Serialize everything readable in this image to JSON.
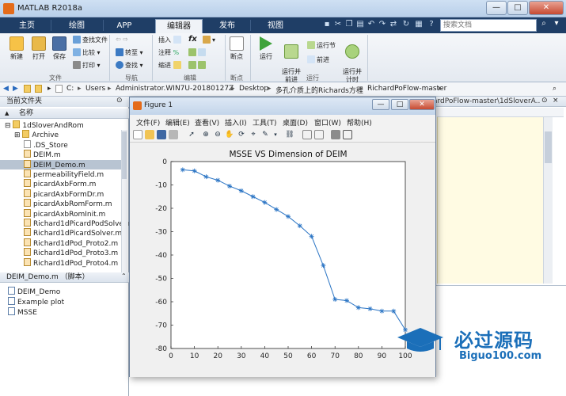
{
  "window": {
    "title": "MATLAB R2018a"
  },
  "tabs": [
    {
      "label": "主页",
      "active": false
    },
    {
      "label": "绘图",
      "active": false
    },
    {
      "label": "APP",
      "active": false
    },
    {
      "label": "编辑器",
      "active": true
    },
    {
      "label": "发布",
      "active": false
    },
    {
      "label": "视图",
      "active": false
    }
  ],
  "search": {
    "placeholder": "搜索文档"
  },
  "ribbon": {
    "file": {
      "label": "文件",
      "new": "新建",
      "open": "打开",
      "save": "保存",
      "find_files": "查找文件",
      "compare": "比较",
      "print": "打印"
    },
    "navigate": {
      "label": "导航",
      "goto": "转至",
      "find": "查找"
    },
    "edit": {
      "label": "编辑",
      "insert": "插入",
      "comment": "注释",
      "indent": "缩进",
      "fx": "fx"
    },
    "breakpoints": {
      "label": "断点",
      "button": "断点"
    },
    "run": {
      "label": "运行",
      "run": "运行",
      "run_advance": "运行并\n前进",
      "run_section": "运行节",
      "advance": "前进",
      "run_time": "运行并\n计时"
    }
  },
  "address": {
    "crumbs": [
      "C:",
      "Users",
      "Administrator.WIN7U-20180127Z",
      "Desktop",
      "多孔介质上的Richards方程",
      "RichardPoFlow-master"
    ]
  },
  "current_folder": {
    "header": "当前文件夹",
    "column": "名称",
    "items": [
      {
        "name": "1dSloverAndRom",
        "type": "folder",
        "selected": false
      },
      {
        "name": "Archive",
        "type": "folder",
        "selected": false
      },
      {
        "name": ".DS_Store",
        "type": "plain",
        "selected": false
      },
      {
        "name": "DEIM.m",
        "type": "m",
        "selected": false
      },
      {
        "name": "DEIM_Demo.m",
        "type": "m",
        "selected": true
      },
      {
        "name": "permeabilityField.m",
        "type": "m",
        "selected": false
      },
      {
        "name": "picardAxbForm.m",
        "type": "m",
        "selected": false
      },
      {
        "name": "picardAxbFormDr.m",
        "type": "m",
        "selected": false
      },
      {
        "name": "picardAxbRomForm.m",
        "type": "m",
        "selected": false
      },
      {
        "name": "picardAxbRomInit.m",
        "type": "m",
        "selected": false
      },
      {
        "name": "Richard1dPicardPodSolver.m",
        "type": "m",
        "selected": false
      },
      {
        "name": "Richard1dPicardSolver.m",
        "type": "m",
        "selected": false
      },
      {
        "name": "Richard1dPod_Proto2.m",
        "type": "m",
        "selected": false
      },
      {
        "name": "Richard1dPod_Proto3.m",
        "type": "m",
        "selected": false
      },
      {
        "name": "Richard1dPod_Proto4.m",
        "type": "m",
        "selected": false
      }
    ]
  },
  "details": {
    "header": "DEIM_Demo.m （脚本）",
    "items": [
      "DEIM_Demo",
      "Example plot",
      "MSSE"
    ]
  },
  "editor": {
    "tab_label": "ardPoFlow-master\\1dSloverA..."
  },
  "figure": {
    "title": "Figure 1",
    "menu": [
      "文件(F)",
      "编辑(E)",
      "查看(V)",
      "插入(I)",
      "工具(T)",
      "桌面(D)",
      "窗口(W)",
      "帮助(H)"
    ]
  },
  "chart_data": {
    "type": "line",
    "title": "MSSE VS Dimension of DEIM",
    "xlabel": "",
    "ylabel": "",
    "xlim": [
      0,
      100
    ],
    "ylim": [
      -80,
      0
    ],
    "xticks": [
      0,
      10,
      20,
      30,
      40,
      50,
      60,
      70,
      80,
      90,
      100
    ],
    "yticks": [
      0,
      -10,
      -20,
      -30,
      -40,
      -50,
      -60,
      -70,
      -80
    ],
    "color": "#2a74c4",
    "marker": "*",
    "series": [
      {
        "x": [
          5,
          10,
          15,
          20,
          25,
          30,
          35,
          40,
          45,
          50,
          55,
          60,
          65,
          70,
          75,
          80,
          85,
          90,
          95,
          100
        ],
        "y": [
          -3.5,
          -4,
          -6.5,
          -8,
          -10.5,
          -12.5,
          -15,
          -17.5,
          -20.5,
          -23.5,
          -27.5,
          -32,
          -44.5,
          -59,
          -59.5,
          -62.5,
          -63,
          -64,
          -64,
          -72
        ]
      }
    ]
  },
  "watermark": {
    "line1": "必过源码",
    "line2": "Biguo100.com"
  }
}
